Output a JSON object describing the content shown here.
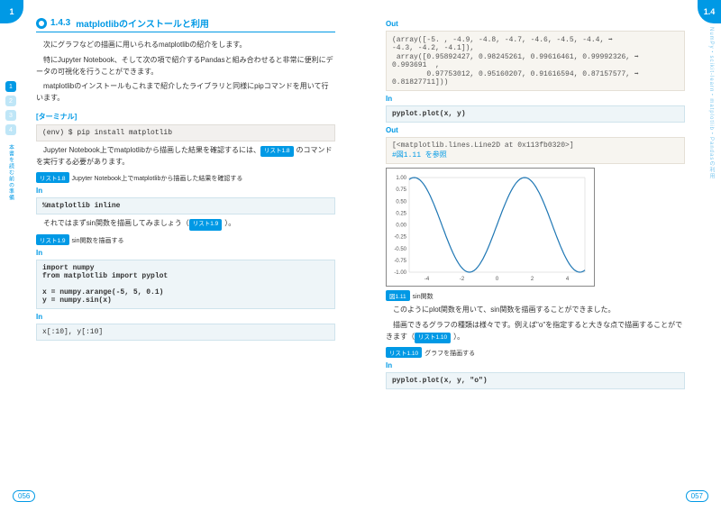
{
  "corner_left": "1",
  "corner_right": "1.4",
  "dots": [
    "1",
    "2",
    "3",
    "4"
  ],
  "sidetext_left": "本書を読む前の準備",
  "sidetext_right": "NumPy・scikit-learn・matplotlib・Pandasの利用",
  "sect_num": "1.4.3",
  "sect_title": "matplotlibのインストールと利用",
  "p1": "　次にグラフなどの描画に用いられるmatplotlibの紹介をします。",
  "p2": "　特にJupyter Notebook、そして次の項で紹介するPandasと組み合わせると非常に便利にデータの可視化を行うことができます。",
  "p3": "　matplotlibのインストールもこれまで紹介したライブラリと同様にpipコマンドを用いて行います。",
  "term": "[ターミナル]",
  "pip": "(env) $ pip install matplotlib",
  "p4_a": "　Jupyter Notebook上でmatplotlibから描画した結果を確認するには、",
  "p4_tag": "リスト1.8",
  "p4_b": "のコマンドを実行する必要があります。",
  "cap18_tag": "リスト1.8",
  "cap18": "Jupyter Notebook上でmatplotlibから描画した結果を確認する",
  "in": "In",
  "out": "Out",
  "code_inline": "%matplotlib inline",
  "p5_a": "　それではまずsin関数を描画してみましょう（",
  "p5_tag": "リスト1.9",
  "p5_b": "）。",
  "cap19_tag": "リスト1.9",
  "cap19": "sin関数を描画する",
  "code_sin": "import numpy\nfrom matplotlib import pyplot\n\nx = numpy.arange(-5, 5, 0.1)\ny = numpy.sin(x)",
  "code_xy": "x[:10], y[:10]",
  "out_arr": "(array([-5. , -4.9, -4.8, -4.7, -4.6, -4.5, -4.4, ➡\n-4.3, -4.2, -4.1]),\n array([0.95892427, 0.98245261, 0.99616461, 0.99992326, ➡\n0.993691  ,\n        0.97753012, 0.95160207, 0.91616594, 0.87157577, ➡\n0.81827711]))",
  "code_plot": "pyplot.plot(x, y)",
  "out_line": "[<matplotlib.lines.Line2D at 0x113fb0320>]",
  "out_figref": "#図1.11 を参照",
  "fig_tag": "図1.11",
  "fig_cap": "sin関数",
  "p6": "　このようにplot関数を用いて、sin関数を描画することができました。",
  "p7_a": "　描画できるグラフの種類は様々です。例えば\"o\"を指定すると大きな点で描画することができます（",
  "p7_tag": "リスト1.10",
  "p7_b": "）。",
  "cap110_tag": "リスト1.10",
  "cap110": "グラフを描画する",
  "code_ploto": "pyplot.plot(x, y, \"o\")",
  "page_l": "056",
  "page_r": "057",
  "chart_data": {
    "type": "line",
    "title": "",
    "xlabel": "",
    "ylabel": "",
    "xlim": [
      -5,
      5
    ],
    "ylim": [
      -1,
      1
    ],
    "xticks": [
      -4,
      -2,
      0,
      2,
      4
    ],
    "yticks": [
      -1.0,
      -0.75,
      -0.5,
      -0.25,
      0.0,
      0.25,
      0.5,
      0.75,
      1.0
    ],
    "series": [
      {
        "name": "sin(x)",
        "x_start": -5,
        "x_end": 5,
        "x_step": 0.1,
        "fn": "sin"
      }
    ]
  }
}
